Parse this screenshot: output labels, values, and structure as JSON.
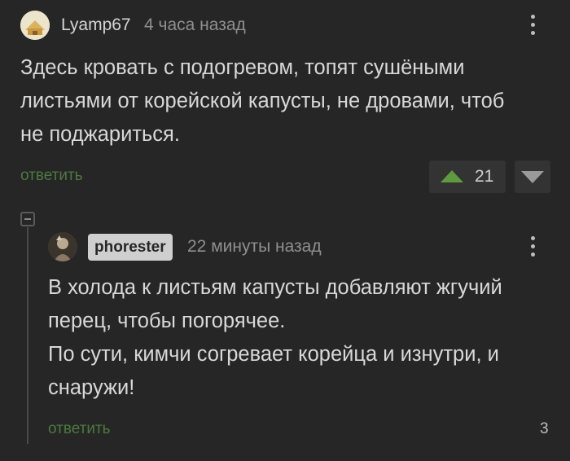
{
  "comment1": {
    "username": "Lyamp67",
    "time": "4 часа назад",
    "text_lines": [
      "Здесь кровать с подогревом, топят сушёными",
      "листьями от корейской капусты, не дровами, чтоб",
      "не поджариться."
    ],
    "reply_label": "ответить",
    "votes": "21"
  },
  "comment2": {
    "username": "phorester",
    "time": "22 минуты назад",
    "text_lines": [
      "В холода к листьям капусты добавляют жгучий",
      "перец, чтобы погорячее.",
      "По сути, кимчи согревает корейца и изнутри, и",
      "снаружи!"
    ],
    "reply_label": "ответить",
    "reply_count": "3"
  },
  "colors": {
    "background": "#262626",
    "reply_link": "#4c7a3f",
    "upvote": "#5e9b3f"
  },
  "icons": {
    "menu": "kebab-vertical-icon",
    "upvote": "triangle-up-icon",
    "downvote": "triangle-down-icon",
    "collapse": "minus-box-icon"
  }
}
